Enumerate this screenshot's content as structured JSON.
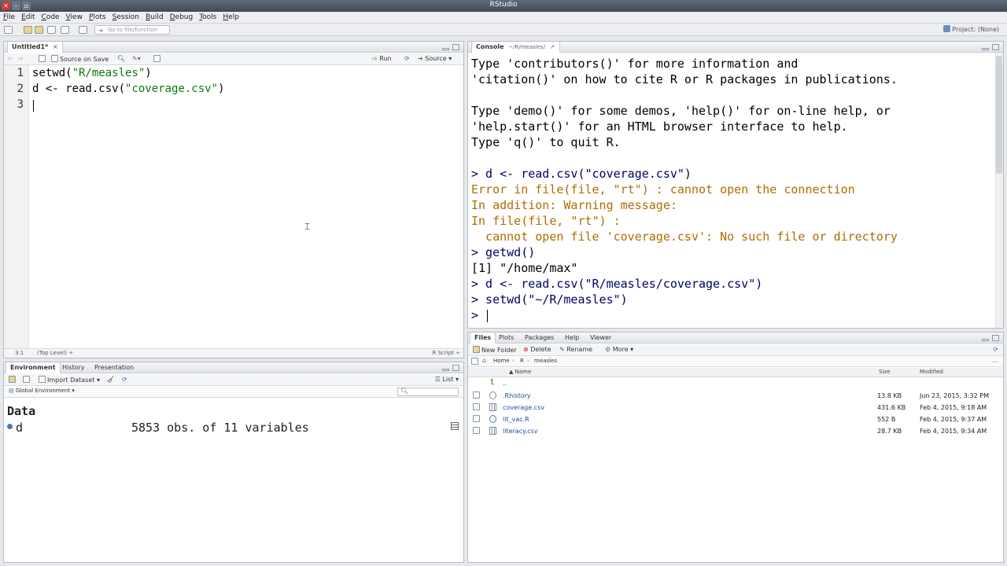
{
  "window": {
    "title": "RStudio"
  },
  "menu": [
    "File",
    "Edit",
    "Code",
    "View",
    "Plots",
    "Session",
    "Build",
    "Debug",
    "Tools",
    "Help"
  ],
  "toolbar": {
    "goto_placeholder": "Go to file/function",
    "project": "Project: (None)"
  },
  "editor": {
    "tab": "Untitled1*",
    "source_on_save": "Source on Save",
    "run": "Run",
    "source": "Source",
    "line_numbers": [
      "1",
      "2",
      "3"
    ],
    "lines": [
      {
        "fn": "setwd(",
        "str": "\"R/measles\"",
        "end": ")"
      },
      {
        "fn": "d <- read.csv(",
        "str": "\"coverage.csv\"",
        "end": ")"
      },
      {
        "fn": "",
        "str": "",
        "end": ""
      }
    ],
    "status_pos": "3:1",
    "status_scope": "(Top Level) ÷",
    "status_type": "R Script ÷"
  },
  "console": {
    "tab": "Console",
    "path": "~/R/measles/",
    "lines": [
      {
        "kind": "out",
        "text": "Type 'contributors()' for more information and"
      },
      {
        "kind": "out",
        "text": "'citation()' on how to cite R or R packages in publications."
      },
      {
        "kind": "out",
        "text": ""
      },
      {
        "kind": "out",
        "text": "Type 'demo()' for some demos, 'help()' for on-line help, or"
      },
      {
        "kind": "out",
        "text": "'help.start()' for an HTML browser interface to help."
      },
      {
        "kind": "out",
        "text": "Type 'q()' to quit R."
      },
      {
        "kind": "out",
        "text": ""
      },
      {
        "kind": "cmd",
        "text": "> d <- read.csv(\"coverage.csv\")"
      },
      {
        "kind": "err",
        "text": "Error in file(file, \"rt\") : cannot open the connection"
      },
      {
        "kind": "err",
        "text": "In addition: Warning message:"
      },
      {
        "kind": "err",
        "text": "In file(file, \"rt\") :"
      },
      {
        "kind": "err",
        "text": "  cannot open file 'coverage.csv': No such file or directory"
      },
      {
        "kind": "cmd",
        "text": "> getwd()"
      },
      {
        "kind": "out",
        "text": "[1] \"/home/max\""
      },
      {
        "kind": "cmd",
        "text": "> d <- read.csv(\"R/measles/coverage.csv\")"
      },
      {
        "kind": "cmd",
        "text": "> setwd(\"~/R/measles\")"
      },
      {
        "kind": "cmd",
        "text": "> "
      }
    ]
  },
  "environment": {
    "tabs": [
      "Environment",
      "History",
      "Presentation"
    ],
    "import_dataset": "Import Dataset ▾",
    "list_view": "List ▾",
    "scope": "Global Environment ▾",
    "section": "Data",
    "rows": [
      {
        "name": "d",
        "value": "5853 obs. of 11 variables"
      }
    ]
  },
  "files": {
    "tabs": [
      "Files",
      "Plots",
      "Packages",
      "Help",
      "Viewer"
    ],
    "new_folder": "New Folder",
    "delete": "Delete",
    "rename": "Rename",
    "more": "More ▾",
    "breadcrumb": [
      "Home",
      "R",
      "measles"
    ],
    "columns": {
      "name": "Name",
      "size": "Size",
      "modified": "Modified"
    },
    "parent": "..",
    "rows": [
      {
        "name": ".Rhistory",
        "size": "13.8 KB",
        "modified": "Jun 23, 2015, 3:32 PM"
      },
      {
        "name": "coverage.csv",
        "size": "431.6 KB",
        "modified": "Feb 4, 2015, 9:18 AM"
      },
      {
        "name": "lit_vac.R",
        "size": "552 B",
        "modified": "Feb 4, 2015, 9:37 AM"
      },
      {
        "name": "literacy.csv",
        "size": "28.7 KB",
        "modified": "Feb 4, 2015, 9:34 AM"
      }
    ]
  }
}
